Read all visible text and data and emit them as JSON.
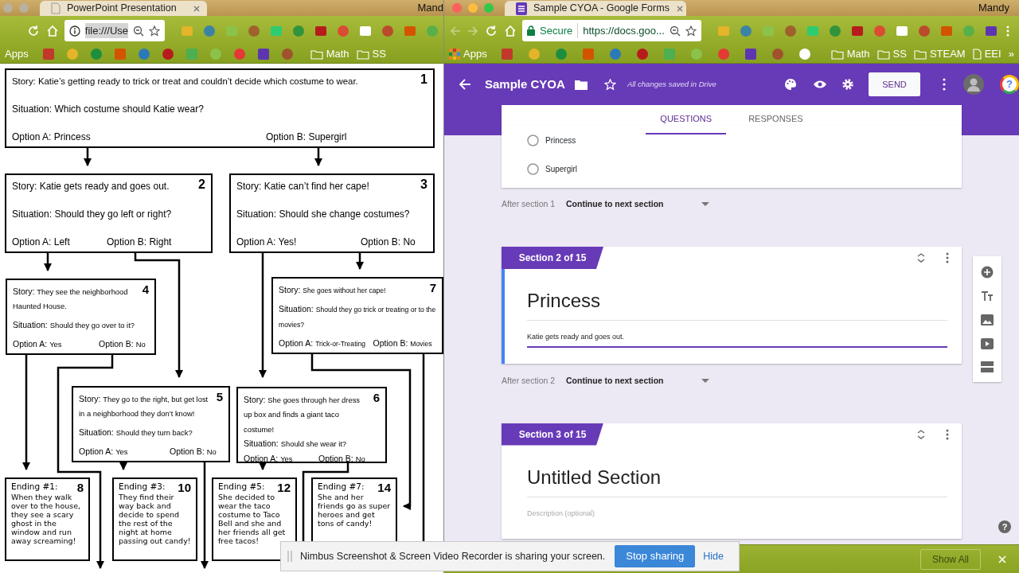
{
  "left_window": {
    "tab_title": "PowerPoint Presentation",
    "user": "Mand",
    "address": "file:///Use",
    "bookmarks": [
      {
        "kind": "text",
        "label": "Apps"
      },
      {
        "kind": "folder",
        "label": "Math"
      },
      {
        "kind": "folder",
        "label": "SS"
      }
    ]
  },
  "flowchart": {
    "nodes": [
      {
        "kind": "decision",
        "number": "1",
        "story_label": "Story:",
        "story": "Katie’s getting ready to trick or treat and couldn’t decide which costume to wear.",
        "situation_label": "Situation:",
        "situation": "Which costume should Katie wear?",
        "option_a_label": "Option A:",
        "option_a": "Princess",
        "option_b_label": "Option B:",
        "option_b": "Supergirl"
      },
      {
        "kind": "decision",
        "number": "2",
        "story_label": "Story:",
        "story": "Katie gets ready and goes out.",
        "situation_label": "Situation:",
        "situation": "Should they go left or right?",
        "option_a_label": "Option A:",
        "option_a": "Left",
        "option_b_label": "Option B:",
        "option_b": "Right"
      },
      {
        "kind": "decision",
        "number": "3",
        "story_label": "Story:",
        "story": "Katie can’t find her cape!",
        "situation_label": "Situation:",
        "situation": "Should she change costumes?",
        "option_a_label": "Option A:",
        "option_a": "Yes!",
        "option_b_label": "Option B:",
        "option_b": "No"
      },
      {
        "kind": "decision",
        "number": "4",
        "story_label": "Story:",
        "story": "They see the neighborhood Haunted House.",
        "situation_label": "Situation:",
        "situation": "Should they go over to it?",
        "option_a_label": "Option A:",
        "option_a": "Yes",
        "option_b_label": "Option B:",
        "option_b": "No"
      },
      {
        "kind": "decision",
        "number": "7",
        "story_label": "Story:",
        "story": "She goes without her cape!",
        "situation_label": "Situation:",
        "situation": "Should they go trick or treating or to the movies?",
        "option_a_label": "Option A:",
        "option_a": "Trick-or-Treating",
        "option_b_label": "Option B:",
        "option_b": "Movies"
      },
      {
        "kind": "decision",
        "number": "5",
        "story_label": "Story:",
        "story": "They go to the right, but get lost in a neighborhood they don’t know!",
        "situation_label": "Situation:",
        "situation": "Should they turn back?",
        "option_a_label": "Option A:",
        "option_a": "Yes",
        "option_b_label": "Option B:",
        "option_b": "No"
      },
      {
        "kind": "decision",
        "number": "6",
        "story_label": "Story:",
        "story": "She goes through her dress up box and finds a giant taco costume!",
        "situation_label": "Situation:",
        "situation": "Should she wear it?",
        "option_a_label": "Option A:",
        "option_a": "Yes",
        "option_b_label": "Option B:",
        "option_b": "No"
      },
      {
        "kind": "ending",
        "number": "8",
        "heading": "Ending #1:",
        "text": "When they walk over to the house, they see a scary ghost in the window and run away screaming!"
      },
      {
        "kind": "ending",
        "number": "10",
        "heading": "Ending #3:",
        "text": "They find their way back and decide to spend the rest of the night at home passing out candy!"
      },
      {
        "kind": "ending",
        "number": "12",
        "heading": "Ending #5:",
        "text": "She decided to wear the taco costume to Taco Bell and she and her friends all get free tacos!"
      },
      {
        "kind": "ending",
        "number": "14",
        "heading": "Ending #7:",
        "text": "She and her friends go as super heroes and get tons of candy!"
      }
    ]
  },
  "right_window": {
    "tab_title": "Sample CYOA - Google Forms",
    "user": "Mandy",
    "security": "Secure",
    "address": "https://docs.goo...",
    "bookmarks": [
      {
        "kind": "apps",
        "label": "Apps"
      },
      {
        "kind": "folder",
        "label": "Math"
      },
      {
        "kind": "folder",
        "label": "SS"
      },
      {
        "kind": "folder",
        "label": "STEAM"
      },
      {
        "kind": "page",
        "label": "EEI"
      },
      {
        "kind": "more",
        "label": "»"
      }
    ]
  },
  "form": {
    "title": "Sample CYOA",
    "save_status": "All changes saved in Drive",
    "send": "SEND",
    "account_help": "?",
    "tabs": [
      {
        "label": "QUESTIONS",
        "selected": true
      },
      {
        "label": "RESPONSES",
        "selected": false
      }
    ],
    "blocks": [
      {
        "kind": "choices",
        "options": [
          {
            "label": "Princess",
            "selected": false
          },
          {
            "label": "Supergirl",
            "selected": false
          }
        ]
      },
      {
        "kind": "after",
        "label": "After section 1",
        "value": "Continue to next section"
      },
      {
        "kind": "section",
        "chip": "Section 2 of 15",
        "title": "Princess",
        "description": "Katie gets ready and goes out.",
        "focused": true
      },
      {
        "kind": "after",
        "label": "After section 2",
        "value": "Continue to next section"
      },
      {
        "kind": "section",
        "chip": "Section 3 of 15",
        "title": "Untitled Section",
        "placeholder": "Description (optional)",
        "focused": false
      }
    ],
    "help": "?"
  },
  "downloads": {
    "show_all": "Show All"
  },
  "sharing_bar": {
    "message": "Nimbus Screenshot & Screen Video Recorder is sharing your screen.",
    "stop": "Stop sharing",
    "hide": "Hide"
  }
}
